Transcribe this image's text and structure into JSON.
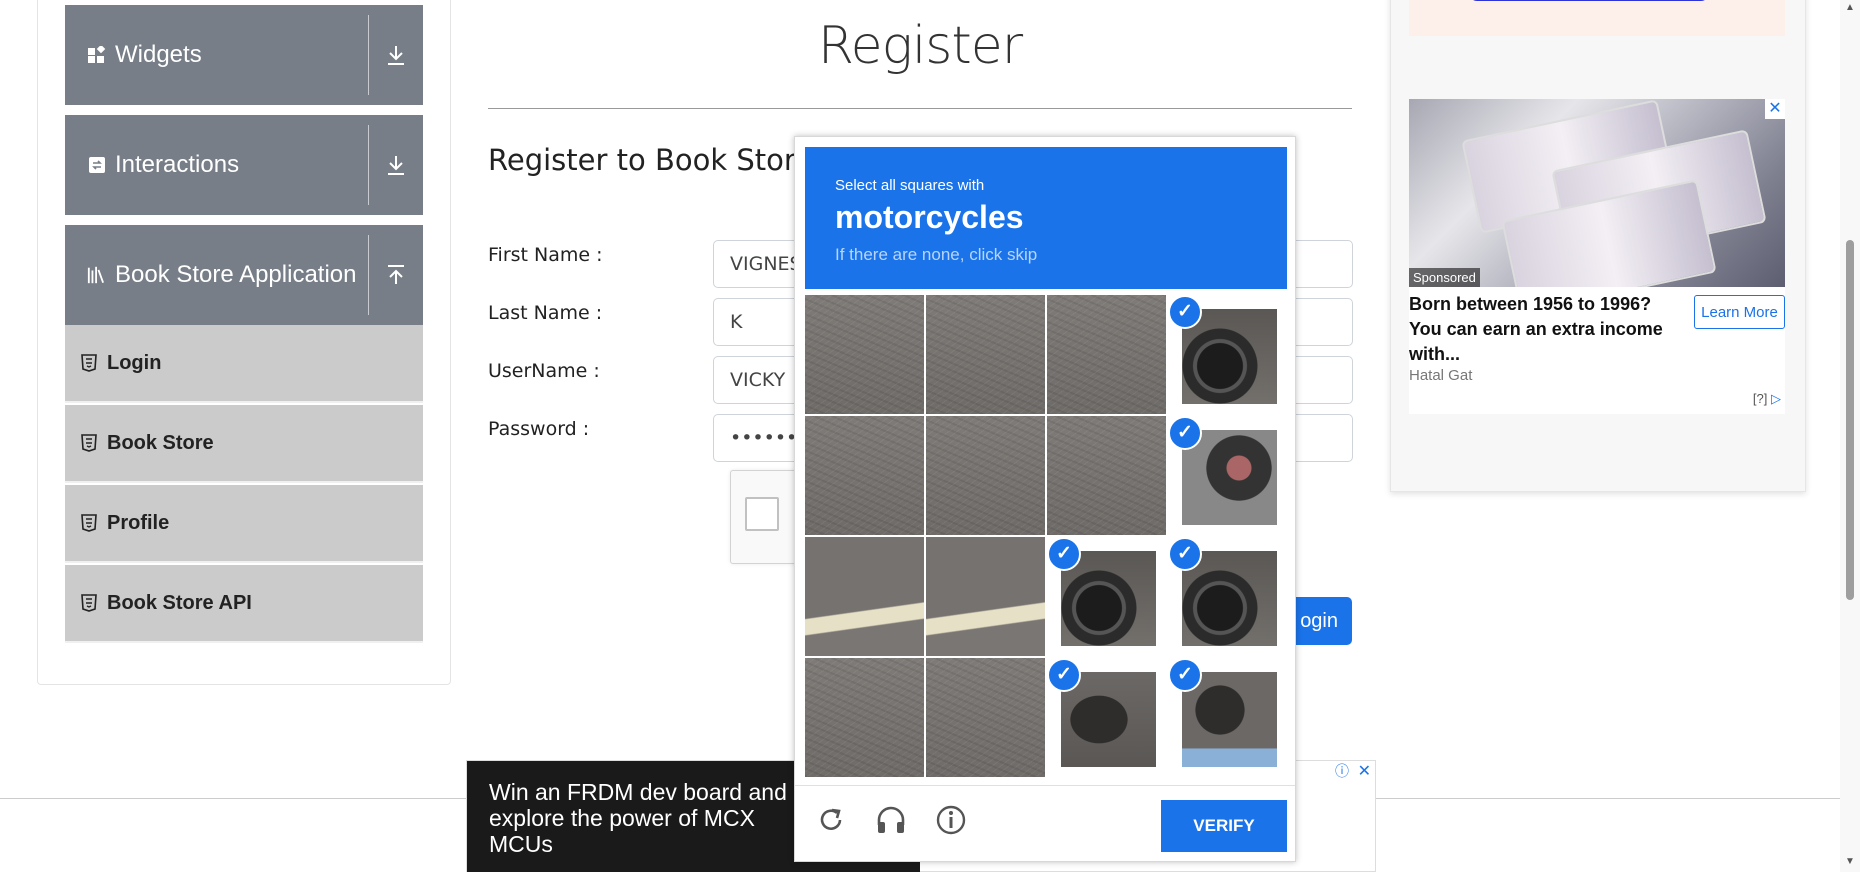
{
  "sidebar": {
    "groups": [
      {
        "title": "Widgets",
        "icon": "widgets-icon",
        "arrow": "download-arrow-icon"
      },
      {
        "title": "Interactions",
        "icon": "interactions-icon",
        "arrow": "download-arrow-icon"
      },
      {
        "title": "Book Store Application",
        "icon": "books-icon",
        "arrow": "upload-arrow-icon"
      }
    ],
    "items": [
      {
        "label": "Login",
        "icon": "html5-icon"
      },
      {
        "label": "Book Store",
        "icon": "html5-icon"
      },
      {
        "label": "Profile",
        "icon": "html5-icon"
      },
      {
        "label": "Book Store API",
        "icon": "html5-icon"
      }
    ]
  },
  "main": {
    "title": "Register",
    "subtitle": "Register to Book Store",
    "fields": [
      {
        "label": "First Name :",
        "value": "VIGNES"
      },
      {
        "label": "Last Name :",
        "value": "K"
      },
      {
        "label": "UserName :",
        "value": "VICKY"
      },
      {
        "label": "Password :",
        "value": "••••••••"
      }
    ],
    "login_button": "ogin"
  },
  "side_ad": {
    "sponsored": "Sponsored",
    "headline": "Born between 1956 to 1996? You can earn an extra income with...",
    "cta": "Learn More",
    "source": "Hatal Gat",
    "choice": "[?]",
    "close": "✕"
  },
  "bottom_ad": {
    "text": "Win an FRDM dev board and explore the power of MCX MCUs",
    "info": "ⓘ",
    "close": "✕"
  },
  "captcha": {
    "prompt_small": "Select all squares with",
    "target": "motorcycles",
    "hint": "If there are none, click skip",
    "verify": "VERIFY",
    "accent": "#1a73e8",
    "tiles": [
      {
        "type": "asphalt",
        "selected": false
      },
      {
        "type": "asphalt",
        "selected": false
      },
      {
        "type": "asphalt",
        "selected": false
      },
      {
        "type": "moto",
        "selected": true
      },
      {
        "type": "asphalt",
        "selected": false
      },
      {
        "type": "asphalt",
        "selected": false
      },
      {
        "type": "asphalt",
        "selected": false
      },
      {
        "type": "moto2",
        "selected": true
      },
      {
        "type": "stripe",
        "selected": false
      },
      {
        "type": "stripe",
        "selected": false
      },
      {
        "type": "moto",
        "selected": true
      },
      {
        "type": "moto",
        "selected": true
      },
      {
        "type": "asphalt",
        "selected": false
      },
      {
        "type": "asphalt",
        "selected": false
      },
      {
        "type": "shadow",
        "selected": true
      },
      {
        "type": "shadow2",
        "selected": true
      }
    ]
  }
}
